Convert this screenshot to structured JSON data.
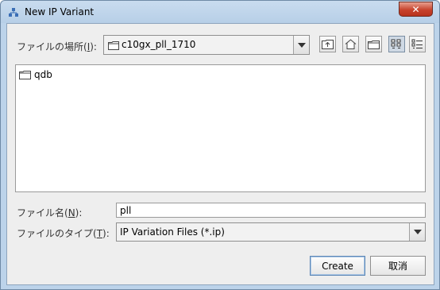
{
  "window": {
    "title": "New IP Variant",
    "close_glyph": "✕"
  },
  "location": {
    "label_prefix": "ファイルの場所(",
    "label_mnemonic": "I",
    "label_suffix": "):",
    "current": "c10gx_pll_1710"
  },
  "toolbar": {
    "icons": [
      "up-one-level-icon",
      "home-icon",
      "new-folder-icon",
      "list-view-icon",
      "details-view-icon"
    ]
  },
  "files": [
    {
      "name": "qdb",
      "icon": "folder-icon"
    }
  ],
  "filename": {
    "label_prefix": "ファイル名(",
    "label_mnemonic": "N",
    "label_suffix": "):",
    "value": "pll"
  },
  "filetype": {
    "label_prefix": "ファイルのタイプ(",
    "label_mnemonic": "T",
    "label_suffix": "):",
    "selected": "IP Variation Files (*.ip)"
  },
  "buttons": {
    "create": "Create",
    "cancel": "取消"
  },
  "colors": {
    "frame": "#bcd3ea",
    "close": "#c7432d",
    "client": "#eeeeee"
  }
}
